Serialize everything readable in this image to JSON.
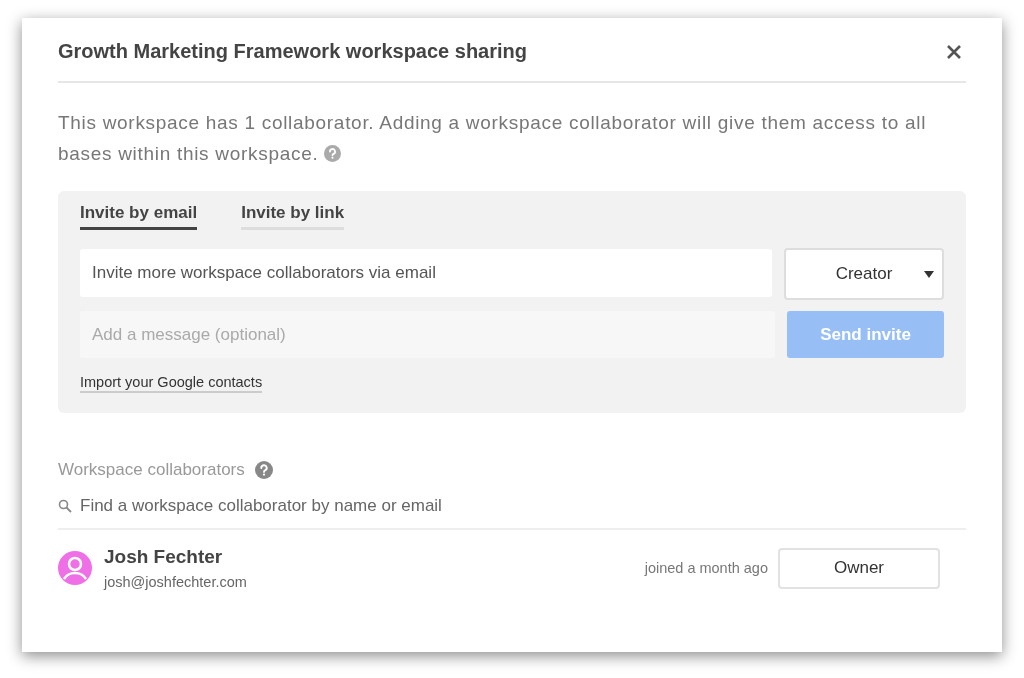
{
  "dialog": {
    "title": "Growth Marketing Framework workspace sharing",
    "description": "This workspace has 1 collaborator. Adding a workspace collaborator will give them access to all bases within this workspace."
  },
  "invite": {
    "tabs": [
      {
        "label": "Invite by email",
        "selected": true
      },
      {
        "label": "Invite by link",
        "selected": false
      }
    ],
    "email_field": {
      "placeholder": "Invite more workspace collaborators via email"
    },
    "role": "Creator",
    "message_field": {
      "placeholder": "Add a message (optional)"
    },
    "send_button": {
      "label": "Send invite",
      "disabled": true
    },
    "import_link": "Import your Google contacts"
  },
  "collaborators": {
    "heading": "Workspace collaborators",
    "search": {
      "placeholder": "Find a workspace collaborator by name or email"
    },
    "rows": [
      {
        "name": "Josh Fechter",
        "email": "josh@joshfechter.com",
        "joined": "joined a month ago",
        "role": "Owner",
        "color": "#ee6fe6"
      }
    ]
  }
}
